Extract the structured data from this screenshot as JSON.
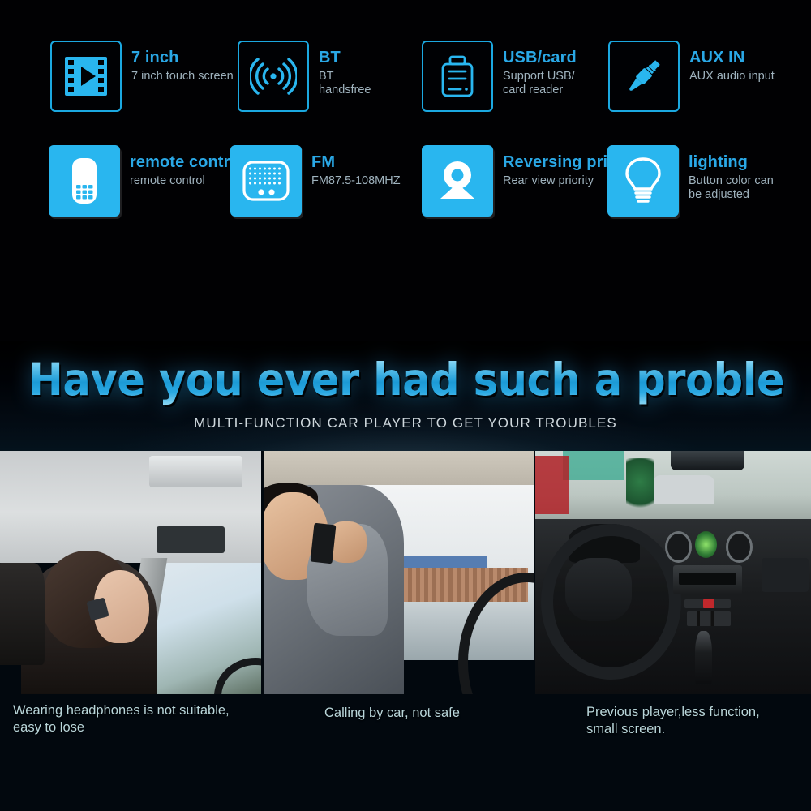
{
  "features": {
    "row1": [
      {
        "icon": "film-play-icon",
        "title": "7 inch",
        "sub": "7 inch touch screen"
      },
      {
        "icon": "bluetooth-wave-icon",
        "title": "BT",
        "sub": "BT\nhandsfree"
      },
      {
        "icon": "usb-card-reader-icon",
        "title": "USB/card",
        "sub": "Support USB/\ncard reader"
      },
      {
        "icon": "aux-jack-icon",
        "title": "AUX IN",
        "sub": "AUX audio input"
      }
    ],
    "row2": [
      {
        "icon": "remote-control-icon",
        "title": "remote control",
        "sub": "remote control"
      },
      {
        "icon": "fm-radio-icon",
        "title": "FM",
        "sub": "FM87.5-108MHZ"
      },
      {
        "icon": "rear-camera-icon",
        "title": "Reversing priority",
        "sub": "Rear view priority"
      },
      {
        "icon": "lightbulb-icon",
        "title": "lighting",
        "sub": "Button color can\nbe adjusted"
      }
    ]
  },
  "hero": {
    "headline": "Have you ever had such a problem?",
    "subhead": "MULTI-FUNCTION CAR PLAYER TO GET YOUR TROUBLES"
  },
  "photos": [
    {
      "name": "woman-wearing-bluetooth-headset-in-car",
      "caption": "Wearing headphones is not suitable,\neasy to lose"
    },
    {
      "name": "man-calling-on-phone-while-driving",
      "caption": "Calling by car, not safe"
    },
    {
      "name": "old-car-dashboard-with-small-screen",
      "caption": "Previous player,less function,\nsmall screen."
    }
  ],
  "colors": {
    "accent_blue": "#29b6ef",
    "title_blue": "#2aa8e6",
    "sub_grey": "#9fb2bd",
    "caption_blue": "#b9d6da",
    "background": "#000000"
  }
}
